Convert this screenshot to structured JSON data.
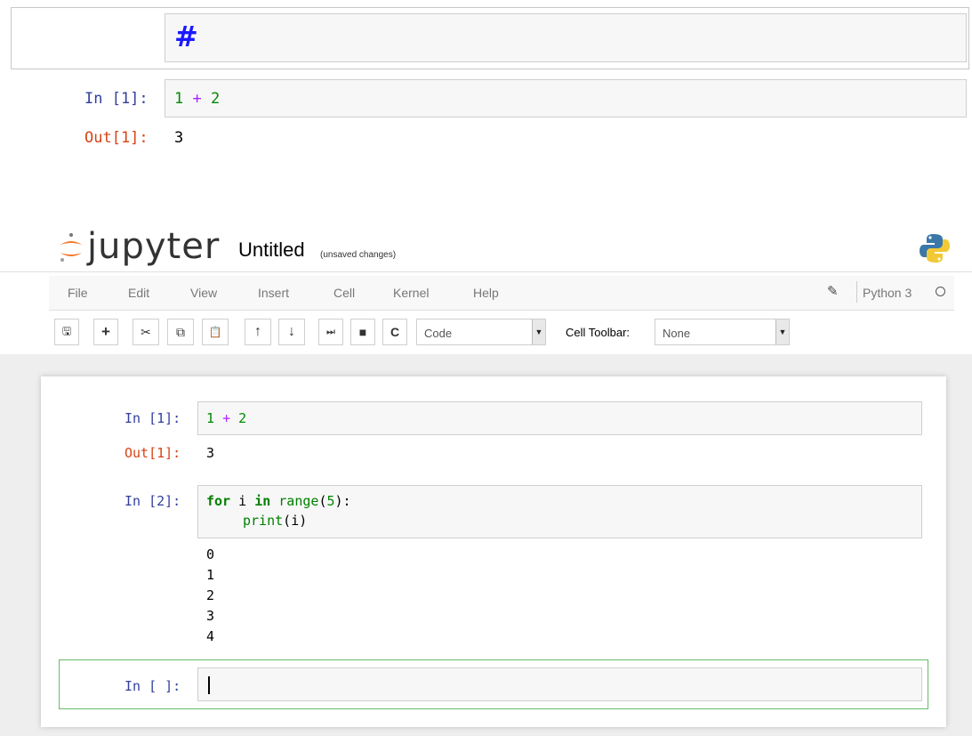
{
  "top_excerpt": {
    "markdown_text": "#",
    "in_prompt": "In [1]:",
    "input_code": {
      "a": "1",
      "op": "+",
      "b": "2"
    },
    "out_prompt": "Out[1]:",
    "output": "3"
  },
  "header": {
    "logo_text": "jupyter",
    "notebook_title": "Untitled",
    "save_status": "(unsaved changes)"
  },
  "menu": {
    "items": [
      "File",
      "Edit",
      "View",
      "Insert",
      "Cell",
      "Kernel",
      "Help"
    ],
    "kernel_name": "Python 3"
  },
  "toolbar": {
    "buttons": [
      {
        "icon": "save-icon",
        "glyph": "🖫"
      },
      {
        "icon": "plus-icon",
        "glyph": "+"
      },
      {
        "icon": "cut-icon",
        "glyph": "✂"
      },
      {
        "icon": "copy-icon",
        "glyph": "⧉"
      },
      {
        "icon": "paste-icon",
        "glyph": "📋"
      },
      {
        "icon": "arrow-up-icon",
        "glyph": "↑"
      },
      {
        "icon": "arrow-down-icon",
        "glyph": "↓"
      },
      {
        "icon": "run-icon",
        "glyph": "⏭"
      },
      {
        "icon": "stop-icon",
        "glyph": "■"
      },
      {
        "icon": "restart-icon",
        "glyph": "C"
      }
    ],
    "cell_type": "Code",
    "cell_toolbar_label": "Cell Toolbar:",
    "cell_toolbar_value": "None"
  },
  "cells": {
    "cell1": {
      "in_prompt": "In [1]:",
      "code_a": "1",
      "code_op": "+",
      "code_b": "2",
      "out_prompt": "Out[1]:",
      "output": "3"
    },
    "cell2": {
      "in_prompt": "In [2]:",
      "line1": {
        "kw_for": "for",
        "var": "i",
        "kw_in": "in",
        "func": "range",
        "open": "(",
        "arg": "5",
        "close": "):"
      },
      "line2": {
        "func": "print",
        "open": "(",
        "arg": "i",
        "close": ")"
      },
      "outputs": [
        "0",
        "1",
        "2",
        "3",
        "4"
      ]
    },
    "cell3": {
      "in_prompt": "In [ ]:"
    }
  },
  "colors": {
    "in_prompt": "#303f9f",
    "out_prompt": "#d84315",
    "active_border": "#66bb6a",
    "logo_orange": "#f37726"
  }
}
